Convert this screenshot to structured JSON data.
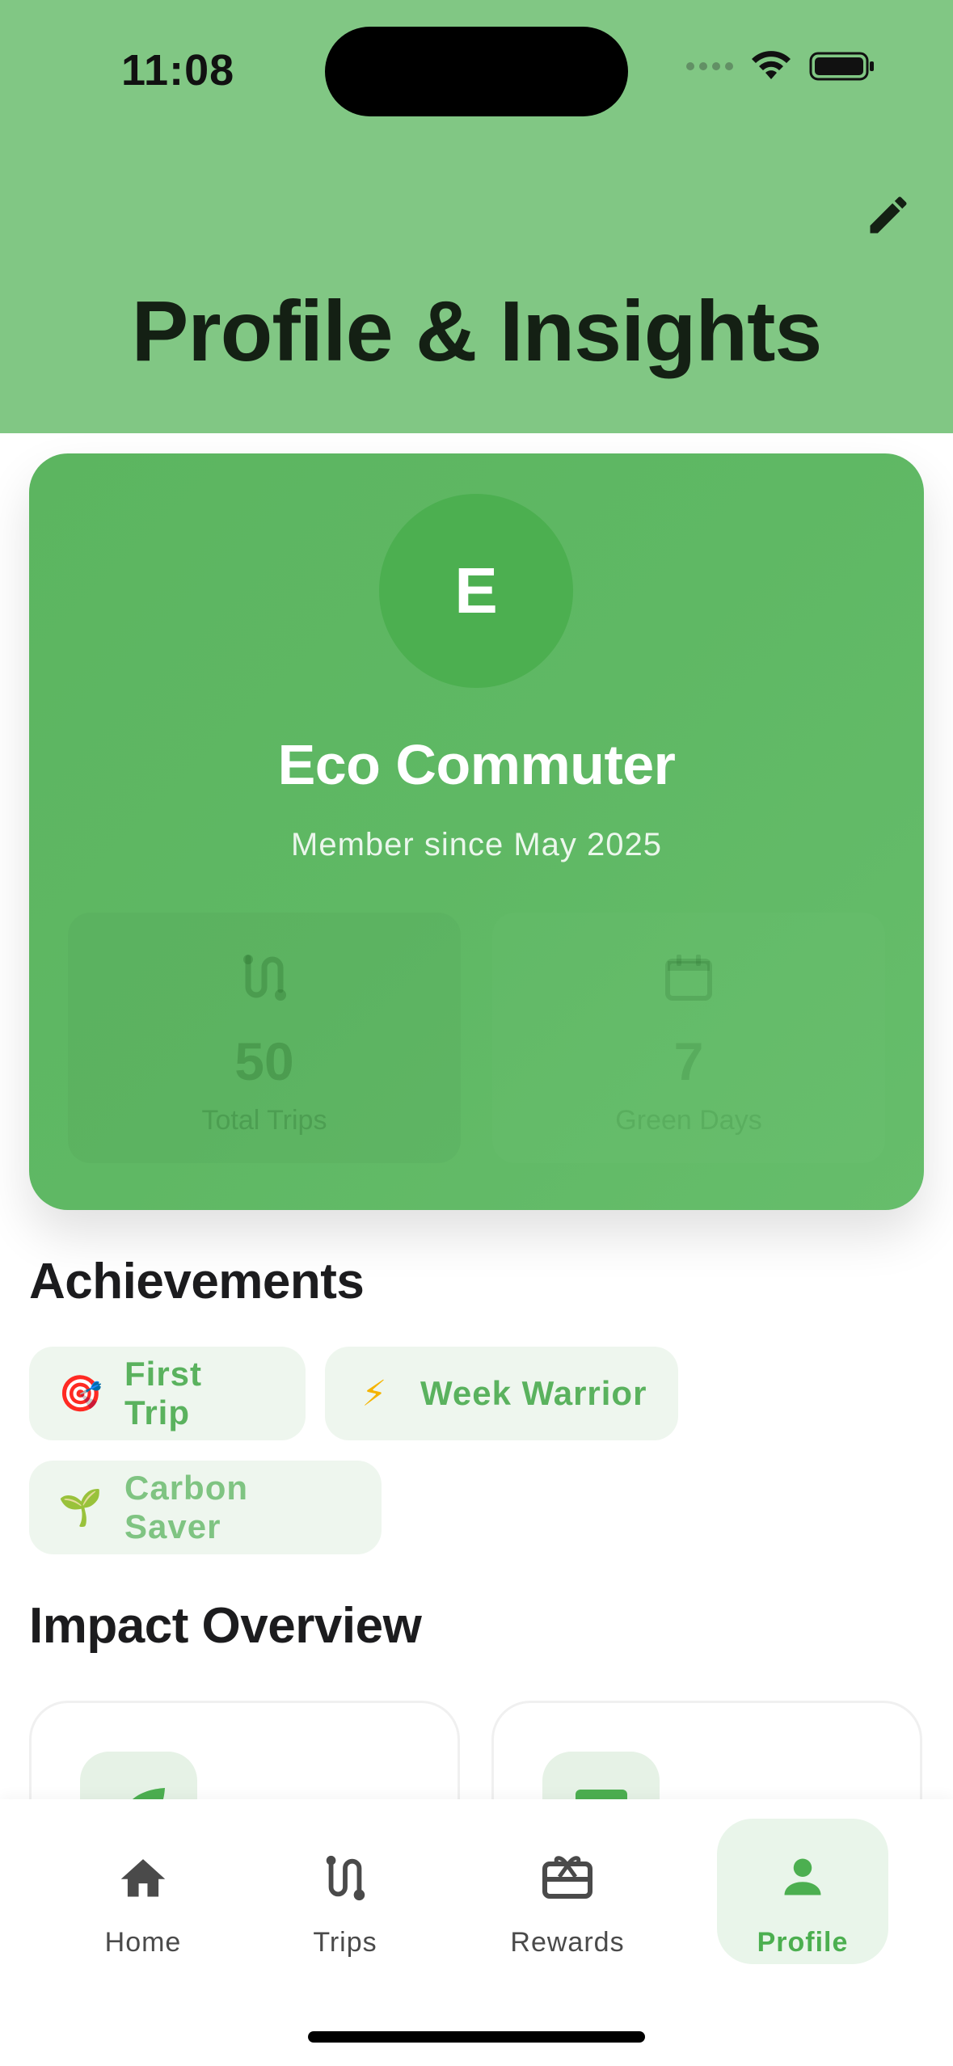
{
  "status_bar": {
    "time": "11:08"
  },
  "header": {
    "title": "Profile & Insights"
  },
  "profile": {
    "initial": "E",
    "name": "Eco Commuter",
    "member_since": "Member since May 2025",
    "stats": [
      {
        "value": "50",
        "label": "Total Trips",
        "icon": "route-icon"
      },
      {
        "value": "7",
        "label": "Green Days",
        "icon": "calendar-icon"
      }
    ]
  },
  "achievements": {
    "title": "Achievements",
    "items": [
      {
        "emoji": "🎯",
        "label": "First Trip"
      },
      {
        "emoji": "⚡",
        "label": "Week Warrior"
      },
      {
        "emoji": "🌱",
        "label": "Carbon Saver"
      }
    ]
  },
  "impact": {
    "title": "Impact Overview"
  },
  "nav": {
    "items": [
      {
        "label": "Home",
        "icon": "home-icon"
      },
      {
        "label": "Trips",
        "icon": "route-icon"
      },
      {
        "label": "Rewards",
        "icon": "gift-card-icon"
      },
      {
        "label": "Profile",
        "icon": "person-icon",
        "active": true
      }
    ]
  },
  "colors": {
    "header": "#81c784",
    "accent": "#4caf50",
    "chip_bg": "#eef6ee"
  }
}
